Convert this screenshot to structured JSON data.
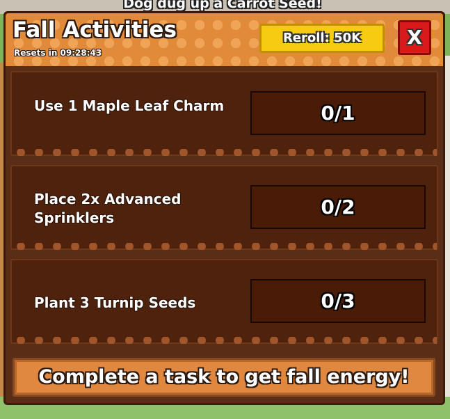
{
  "toast": "Dog dug up a Carrot Seed!",
  "header": {
    "title": "Fall Activities",
    "resets": "Resets in 09:28:43",
    "reroll_label": "Reroll: 50K",
    "close_label": "X"
  },
  "tasks": [
    {
      "label": "Use 1 Maple Leaf Charm",
      "progress": "0/1"
    },
    {
      "label": "Place 2x Advanced Sprinklers",
      "progress": "0/2"
    },
    {
      "label": "Plant 3 Turnip Seeds",
      "progress": "0/3"
    }
  ],
  "footer": "Complete a task to get fall energy!",
  "colors": {
    "panel": "#5a2e16",
    "header": "#e08a3a",
    "reroll": "#f6cb12",
    "close": "#d81a1a"
  }
}
